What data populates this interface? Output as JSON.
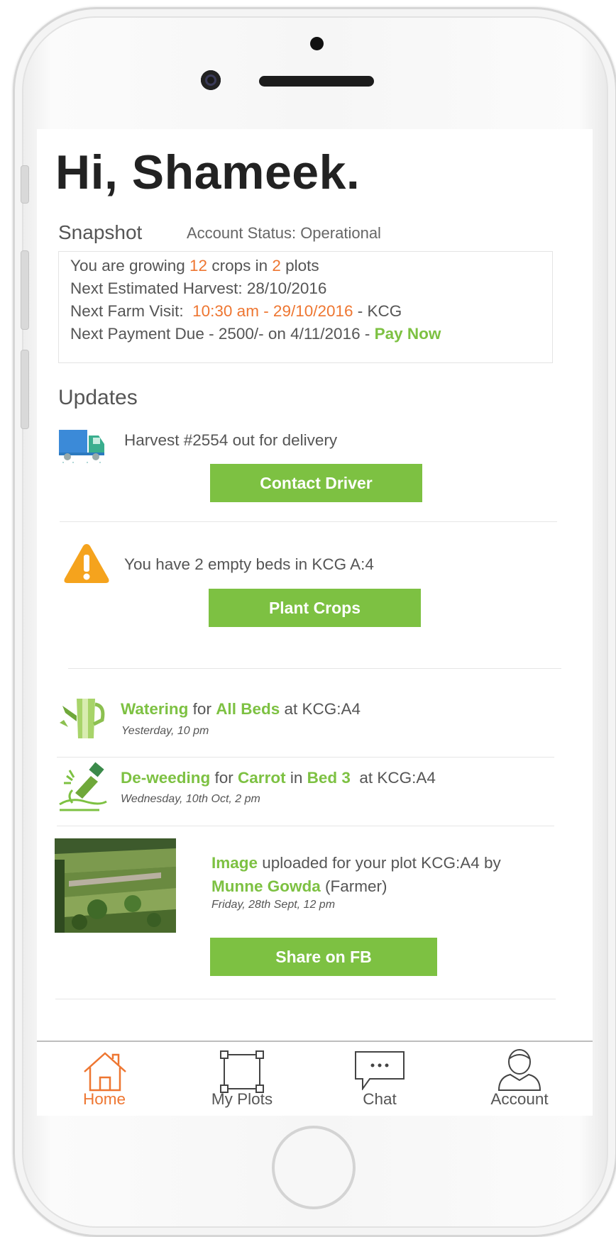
{
  "greeting": "Hi, Shameek.",
  "snapshot": {
    "heading": "Snapshot",
    "account_status": "Account Status: Operational",
    "growing_prefix": "You are growing ",
    "crop_count": "12",
    "growing_mid": " crops in ",
    "plot_count": "2",
    "growing_suffix": " plots",
    "next_harvest": "Next Estimated Harvest: 28/10/2016",
    "farm_visit_label": "Next Farm Visit:  ",
    "farm_visit_time": "10:30 am - 29/10/2016",
    "farm_visit_suffix": " - KCG",
    "payment_text": "Next Payment Due - 2500/- on 4/11/2016 - ",
    "pay_now": "Pay Now"
  },
  "updates": {
    "heading": "Updates",
    "delivery": {
      "text": "Harvest #2554 out for delivery",
      "button": "Contact Driver",
      "icon": "truck-icon"
    },
    "beds_warning": {
      "text": "You have 2 empty beds in KCG A:4",
      "button": "Plant Crops",
      "icon": "warning-icon"
    },
    "activities": [
      {
        "action": "Watering",
        "for_word": " for ",
        "target": "All Beds",
        "suffix": " at KCG:A4",
        "time": "Yesterday, 10 pm",
        "icon": "watering-can-icon"
      },
      {
        "action": "De-weeding",
        "for_word": " for ",
        "target": "Carrot",
        "in_word": " in ",
        "bed": "Bed 3",
        "suffix": "  at KCG:A4",
        "time": "Wednesday, 10th Oct, 2  pm",
        "icon": "weeding-icon"
      }
    ],
    "image_update": {
      "link": "Image",
      "text": " uploaded for your plot KCG:A4 by ",
      "farmer": "Munne Gowda",
      "role": " (Farmer)",
      "time": "Friday, 28th Sept, 12 pm",
      "button": "Share on FB"
    }
  },
  "tabbar": {
    "tabs": [
      {
        "label": "Home",
        "icon": "house-icon",
        "active": true
      },
      {
        "label": "My Plots",
        "icon": "plot-frame-icon",
        "active": false
      },
      {
        "label": "Chat",
        "icon": "chat-bubble-icon",
        "active": false
      },
      {
        "label": "Account",
        "icon": "user-icon",
        "active": false
      }
    ]
  },
  "colors": {
    "accent_green": "#7dc142",
    "accent_orange": "#ee7631",
    "text": "#555555"
  }
}
